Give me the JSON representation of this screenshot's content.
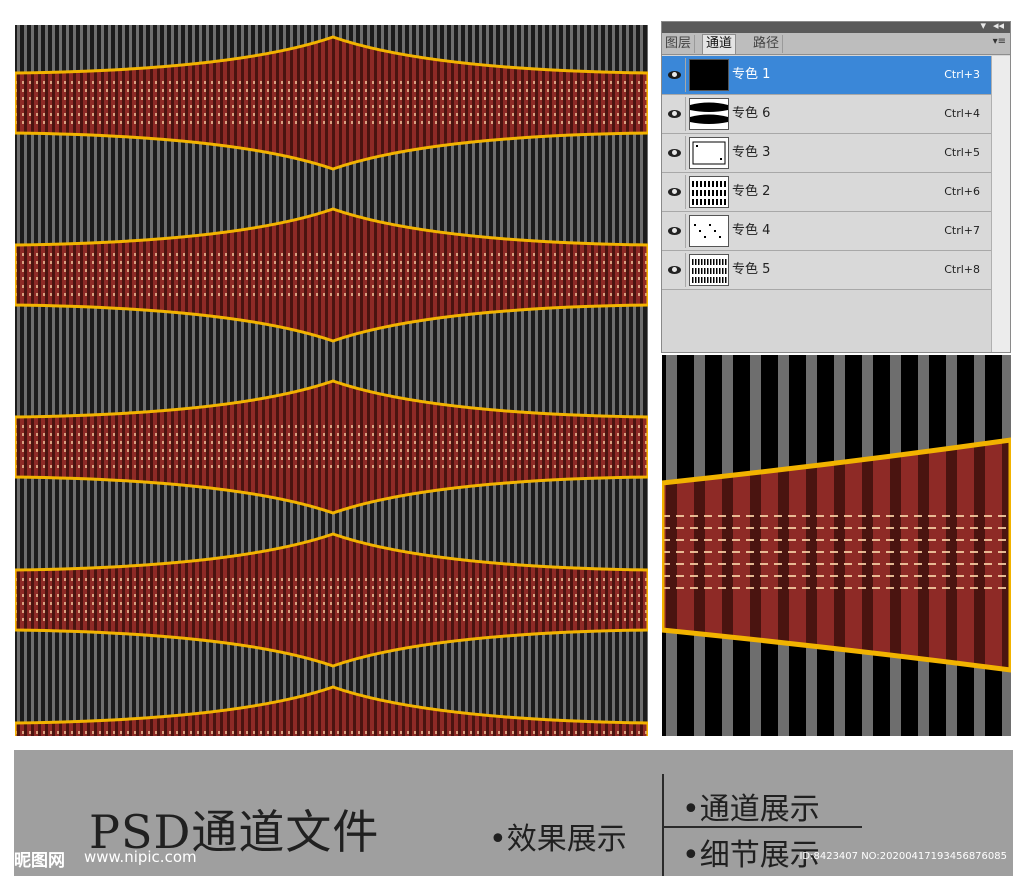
{
  "panel": {
    "tabs": [
      "图层",
      "通道",
      "路径"
    ],
    "active_tab": 1,
    "collapse_glyph": "◂◂",
    "close_glyph": "▾",
    "menu_glyph": "▾≡",
    "channels": [
      {
        "name": "专色 1",
        "shortcut": "Ctrl+3",
        "selected": true,
        "thumb": "solid-black"
      },
      {
        "name": "专色 6",
        "shortcut": "Ctrl+4",
        "selected": false,
        "thumb": "bands"
      },
      {
        "name": "专色 3",
        "shortcut": "Ctrl+5",
        "selected": false,
        "thumb": "frame"
      },
      {
        "name": "专色 2",
        "shortcut": "Ctrl+6",
        "selected": false,
        "thumb": "stripes"
      },
      {
        "name": "专色 4",
        "shortcut": "Ctrl+7",
        "selected": false,
        "thumb": "dots"
      },
      {
        "name": "专色 5",
        "shortcut": "Ctrl+8",
        "selected": false,
        "thumb": "stripes-dense"
      }
    ]
  },
  "caption": {
    "title": "PSD通道文件",
    "bullet_effect": "•效果展示",
    "bullet_channel": "•通道展示",
    "bullet_detail": "•细节展示"
  },
  "watermark": {
    "logo": "昵图网",
    "url": "www.nipic.com",
    "id": "ID:8423407 NO:20200417193456876085"
  },
  "colors": {
    "background_dark": "#1c1c1c",
    "stripe_grey": "#6e6e6e",
    "band_red": "#8e2a26",
    "band_dark_red": "#4a1410",
    "band_outline": "#f2b300",
    "accent_cream": "#f3c9a0",
    "selection_blue": "#3a87d8"
  },
  "icons": {
    "visibility": "eye-icon",
    "panel_menu": "panel-menu-icon",
    "collapse": "double-chevron-left-icon"
  }
}
